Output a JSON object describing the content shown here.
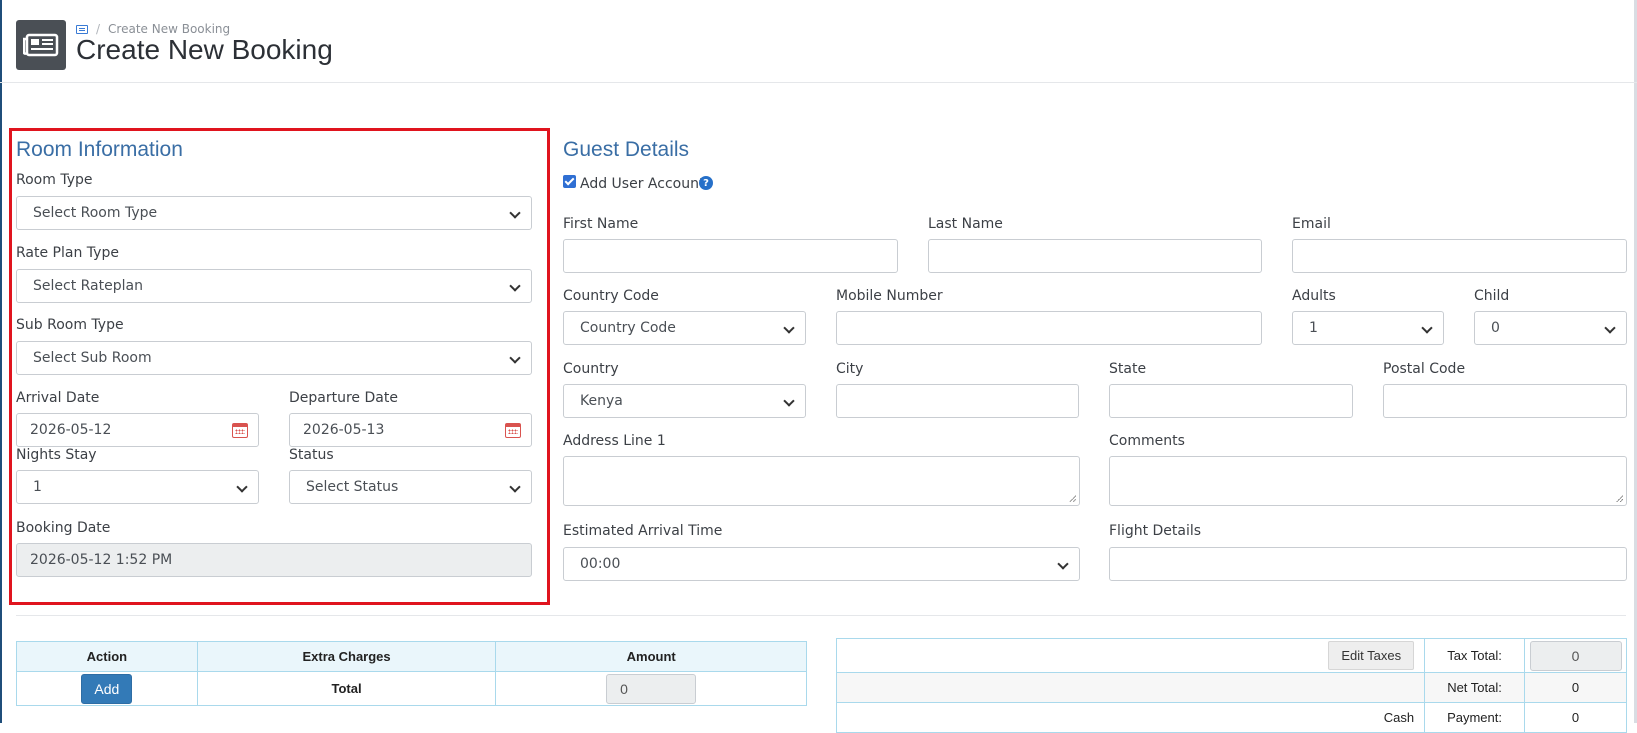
{
  "header": {
    "breadcrumb_current": "Create New Booking",
    "title": "Create New Booking",
    "breadcrumb_separator": "/"
  },
  "room_info": {
    "title": "Room Information",
    "room_type_label": "Room Type",
    "room_type_value": "Select Room Type",
    "rate_plan_label": "Rate Plan Type",
    "rate_plan_value": "Select Rateplan",
    "sub_room_label": "Sub Room Type",
    "sub_room_value": "Select Sub Room",
    "arrival_label": "Arrival Date",
    "arrival_value": "2026-05-12",
    "departure_label": "Departure Date",
    "departure_value": "2026-05-13",
    "nights_label": "Nights Stay",
    "nights_value": "1",
    "status_label": "Status",
    "status_value": "Select Status",
    "booking_date_label": "Booking Date",
    "booking_date_value": "2026-05-12 1:52 PM"
  },
  "guest": {
    "title": "Guest Details",
    "add_user_label": "Add User Account",
    "add_user_checked": true,
    "help_glyph": "?",
    "first_name_label": "First Name",
    "last_name_label": "Last Name",
    "email_label": "Email",
    "country_code_label": "Country Code",
    "country_code_value": "Country Code",
    "mobile_label": "Mobile Number",
    "adults_label": "Adults",
    "adults_value": "1",
    "child_label": "Child",
    "child_value": "0",
    "country_label": "Country",
    "country_value": "Kenya",
    "city_label": "City",
    "state_label": "State",
    "postal_label": "Postal Code",
    "address_label": "Address Line 1",
    "comments_label": "Comments",
    "arrival_time_label": "Estimated Arrival Time",
    "arrival_time_value": "00:00",
    "flight_label": "Flight Details"
  },
  "charges": {
    "headers": [
      "Action",
      "Extra Charges",
      "Amount"
    ],
    "add_button": "Add",
    "total_label": "Total",
    "total_amount": "0"
  },
  "totals": {
    "edit_taxes_button": "Edit Taxes",
    "tax_total_label": "Tax Total:",
    "tax_total_value": "0",
    "net_total_label": "Net Total:",
    "net_total_value": "0",
    "payment_method": "Cash",
    "payment_label": "Payment:",
    "payment_value": "0"
  },
  "colors": {
    "accent": "#3a6ea5",
    "highlight_border": "#e0141e",
    "primary_button": "#337ab7"
  }
}
